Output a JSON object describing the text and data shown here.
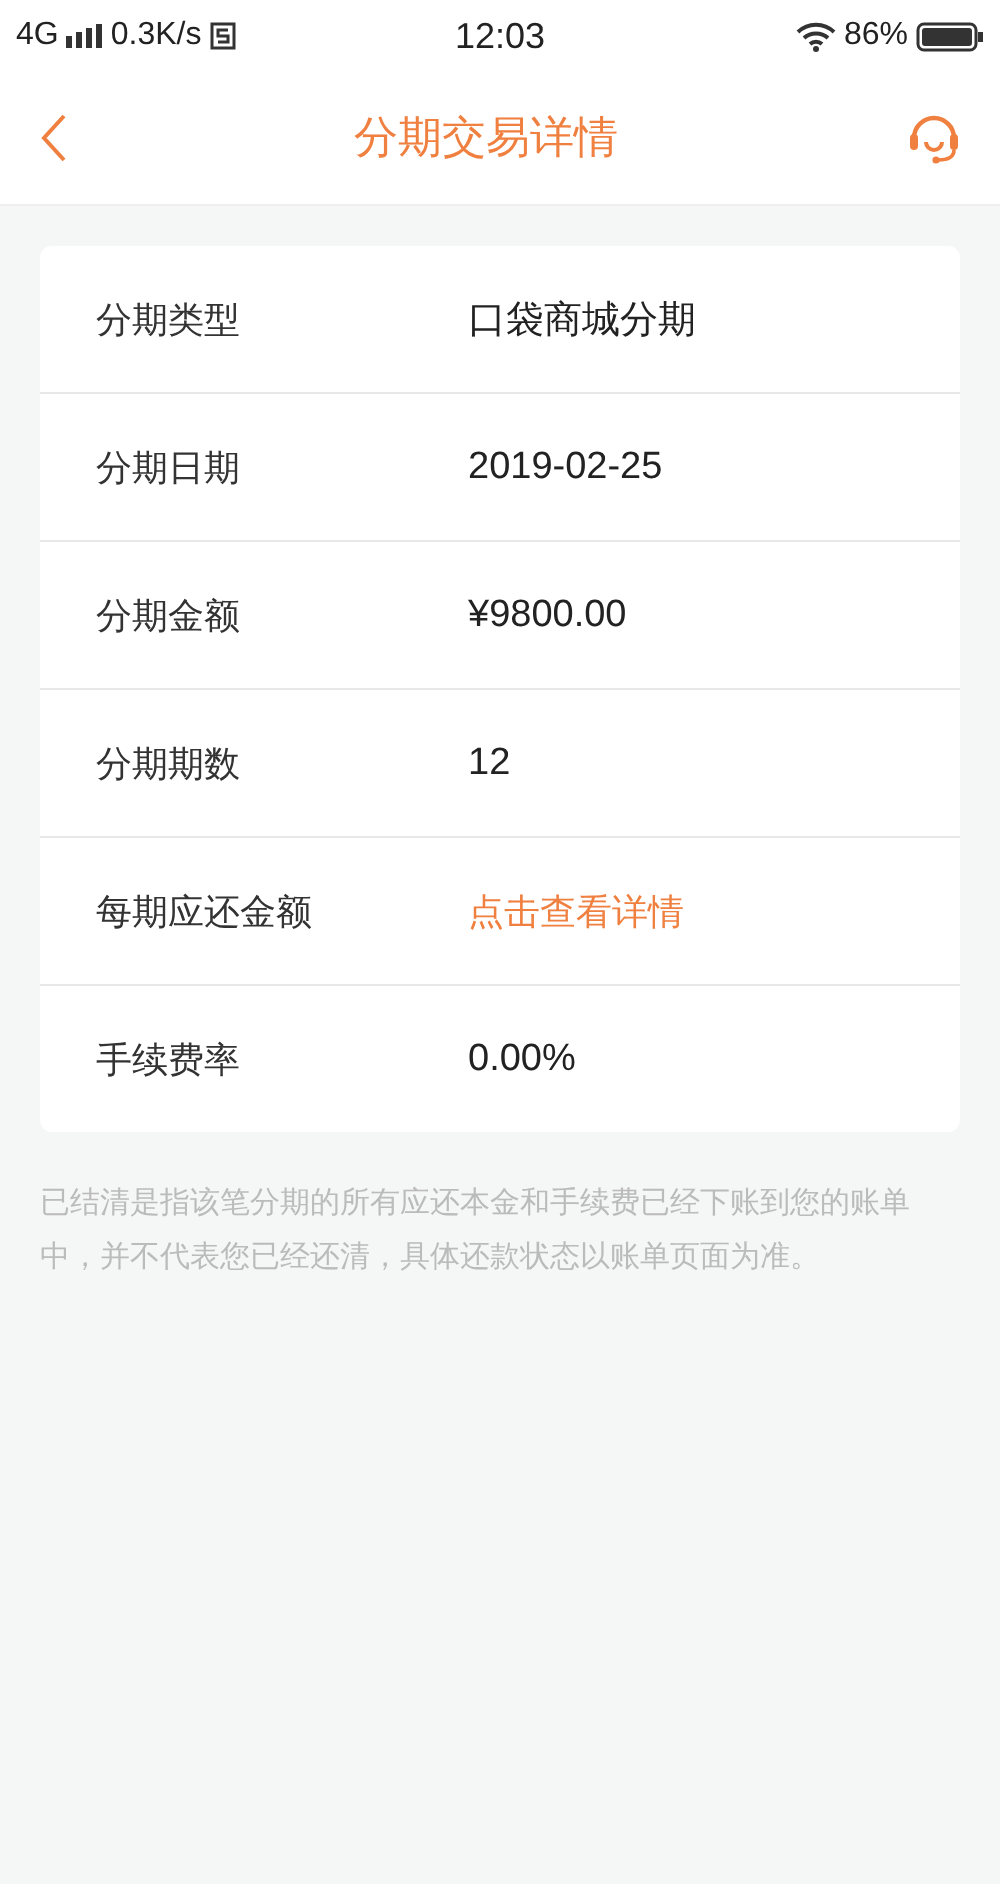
{
  "status_bar": {
    "network": "4G",
    "speed": "0.3K/s",
    "time": "12:03",
    "battery": "86%"
  },
  "header": {
    "title": "分期交易详情"
  },
  "rows": [
    {
      "label": "分期类型",
      "value": "口袋商城分期",
      "kind": "text"
    },
    {
      "label": "分期日期",
      "value": "2019-02-25",
      "kind": "text"
    },
    {
      "label": "分期金额",
      "value": "¥9800.00",
      "kind": "text"
    },
    {
      "label": "分期期数",
      "value": "12",
      "kind": "text"
    },
    {
      "label": "每期应还金额",
      "value": "点击查看详情",
      "kind": "link"
    },
    {
      "label": "手续费率",
      "value": "0.00%",
      "kind": "text"
    }
  ],
  "note": "已结清是指该笔分期的所有应还本金和手续费已经下账到您的账单中，并不代表您已经还清，具体还款状态以账单页面为准。"
}
